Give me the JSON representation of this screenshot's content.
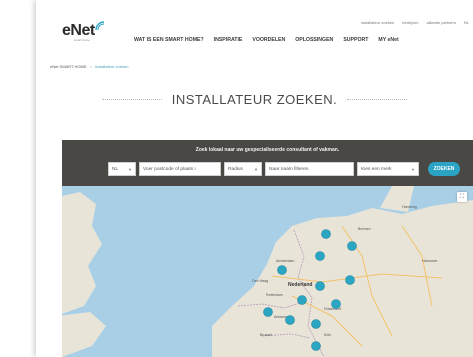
{
  "brand": {
    "logo_text": "eNet",
    "logo_subtext": "smart home",
    "accent_color": "#2aa3c4"
  },
  "top_links": [
    "installateur zoeken",
    "bedrijven",
    "alliantie partners",
    "NL"
  ],
  "main_nav": [
    "WAT IS EEN SMART HOME?",
    "INSPIRATIE",
    "VOORDELEN",
    "OPLOSSINGEN",
    "SUPPORT",
    "MY eNet"
  ],
  "breadcrumb": {
    "home": "eNet SMART HOME",
    "separator": ">",
    "current": "Installateur zoeken"
  },
  "page_title": "INSTALLATEUR ZOEKEN.",
  "search": {
    "intro": "Zoek lokaal naar uw gespecialiseerde consultant of vakman.",
    "country_value": "NL",
    "postcode_placeholder": "Voer postcode of plaats i",
    "radius_value": "Radius",
    "name_filter_placeholder": "Naar naam filteren",
    "mark_value": "Kies een merk",
    "submit_label": "ZOEKEN",
    "band_color": "#4a4845"
  },
  "map": {
    "water_color": "#a8cfe6",
    "land_color": "#e8e4d8",
    "marker_color": "#2ba6c2",
    "country_label": "Nederland",
    "city_labels": [
      "Hamburg",
      "Bremen",
      "Amsterdam",
      "Den Haag",
      "Rotterdam",
      "Antwerpen",
      "Brussel",
      "Düsseldorf",
      "Köln",
      "Hannover"
    ],
    "fullscreen_icon": "fullscreen-icon"
  }
}
